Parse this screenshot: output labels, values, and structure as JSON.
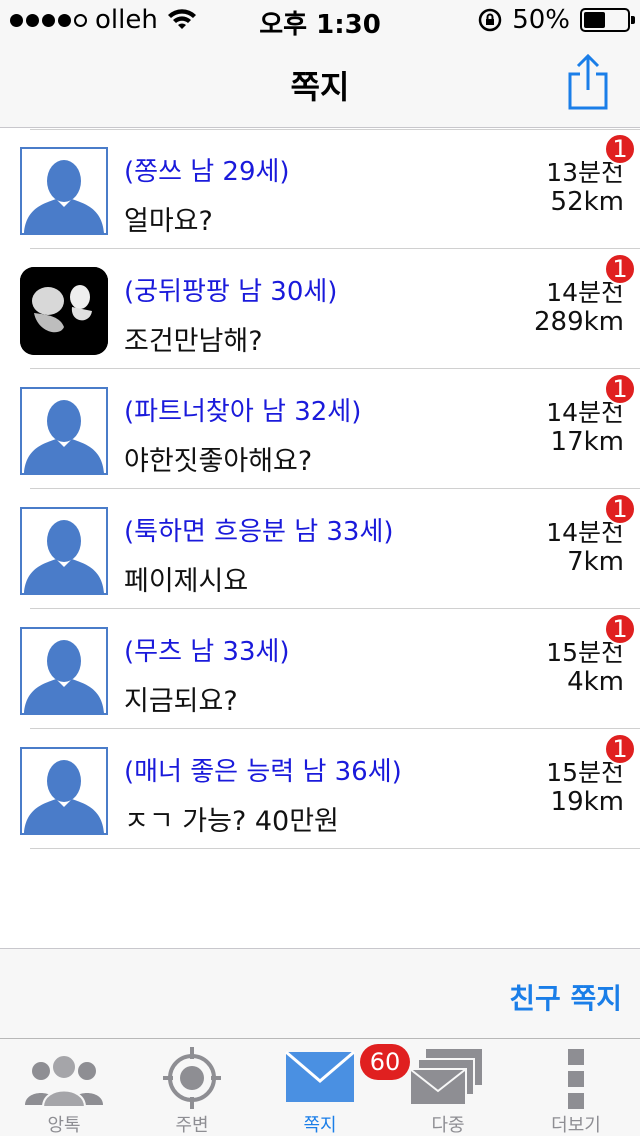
{
  "status_bar": {
    "carrier": "olleh",
    "time": "오후 1:30",
    "battery_percent": "50%",
    "battery_level": 0.5
  },
  "nav": {
    "title": "쪽지",
    "share_icon": "share-icon"
  },
  "messages": [
    {
      "name": "(쫑쓰 남 29세)",
      "text": "얼마요?",
      "time": "13분전",
      "distance": "52km",
      "badge": "1",
      "avatar": "default"
    },
    {
      "name": "(궁뒤팡팡 남 30세)",
      "text": "조건만남해?",
      "time": "14분전",
      "distance": "289km",
      "badge": "1",
      "avatar": "photo"
    },
    {
      "name": "(파트너찾아 남 32세)",
      "text": "야한짓좋아해요?",
      "time": "14분전",
      "distance": "17km",
      "badge": "1",
      "avatar": "default"
    },
    {
      "name": "(툭하면 흐응분 남 33세)",
      "text": "페이제시요",
      "time": "14분전",
      "distance": "7km",
      "badge": "1",
      "avatar": "default"
    },
    {
      "name": "(무츠 남 33세)",
      "text": "지금되요?",
      "time": "15분전",
      "distance": "4km",
      "badge": "1",
      "avatar": "default"
    },
    {
      "name": "(매너 좋은 능력 남 36세)",
      "text": "ㅈㄱ 가능? 40만원",
      "time": "15분전",
      "distance": "19km",
      "badge": "1",
      "avatar": "default"
    }
  ],
  "friend_bar": {
    "button_label": "친구 쪽지"
  },
  "tabs": [
    {
      "label": "앙톡",
      "icon": "people-icon"
    },
    {
      "label": "주변",
      "icon": "target-icon"
    },
    {
      "label": "쪽지",
      "icon": "mail-icon",
      "active": true
    },
    {
      "label": "다중",
      "icon": "multi-mail-icon"
    },
    {
      "label": "더보기",
      "icon": "more-icon"
    }
  ],
  "tab_badge": "60",
  "colors": {
    "accent": "#1a7ee8",
    "name_text": "#1a1adb",
    "badge": "#e02020",
    "avatar": "#4a7cc9"
  }
}
